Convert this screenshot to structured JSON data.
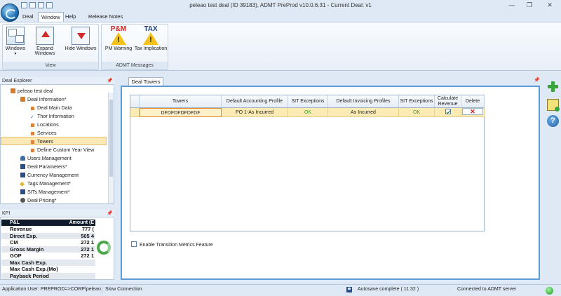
{
  "window": {
    "title": "peleao test deal (ID 39183), ADMT PreProd v10.0.6.31 - Current Deal: v1",
    "minimize_label": "—",
    "restore_label": "❐",
    "close_label": "✕"
  },
  "menu": {
    "tabs": [
      "Deal",
      "Window",
      "Help",
      "Release Notes"
    ],
    "active": "Window"
  },
  "ribbon": {
    "groups": [
      {
        "label": "View",
        "buttons": [
          {
            "label": "Windows",
            "icon": "windows-icon"
          },
          {
            "label": "Expand Windows",
            "icon": "arrow-up-icon"
          },
          {
            "label": "Hide Windows",
            "icon": "arrow-down-icon"
          }
        ]
      },
      {
        "label": "ADMT Messages",
        "buttons": [
          {
            "label": "PM Warning",
            "icon": "pm-warning-icon",
            "icon_caption": "P&M"
          },
          {
            "label": "Tax Implication",
            "icon": "tax-warning-icon",
            "icon_caption": "TAX"
          }
        ]
      }
    ]
  },
  "deal_explorer": {
    "title": "Deal Explorer",
    "items": [
      {
        "label": "peleao test deal",
        "icon": "deal-icon"
      },
      {
        "label": "Deal Information*",
        "icon": "folder-icon"
      },
      {
        "label": "Deal Main Data",
        "icon": "item-icon"
      },
      {
        "label": "Thor Information",
        "icon": "check-icon"
      },
      {
        "label": "Locations",
        "icon": "item-icon"
      },
      {
        "label": "Services",
        "icon": "item-icon"
      },
      {
        "label": "Towers",
        "icon": "item-icon"
      },
      {
        "label": "Define Custom Year View",
        "icon": "item-icon"
      },
      {
        "label": "Users Management",
        "icon": "users-icon"
      },
      {
        "label": "Deal Parameters*",
        "icon": "parameters-icon"
      },
      {
        "label": "Currency Management",
        "icon": "currency-icon"
      },
      {
        "label": "Tags Management*",
        "icon": "tag-icon"
      },
      {
        "label": "SITs Management*",
        "icon": "sits-icon"
      },
      {
        "label": "Deal Pricing*",
        "icon": "pricing-icon"
      }
    ],
    "selected": "Towers"
  },
  "kpi": {
    "title": "KPI",
    "header": {
      "col1": "P&L",
      "col2": "Amount (E"
    },
    "rows": [
      {
        "label": "Revenue",
        "amount": "777 ("
      },
      {
        "label": "Direct Exp.",
        "amount": "505 4"
      },
      {
        "label": "CM",
        "amount": "272 1"
      },
      {
        "label": "Gross Margin",
        "amount": "272 1"
      },
      {
        "label": "GOP",
        "amount": "272 1"
      },
      {
        "label": "Max Cash Exp.",
        "amount": ""
      },
      {
        "label": "Max Cash Exp.(Mo)",
        "amount": ""
      },
      {
        "label": "Payback Period",
        "amount": ""
      }
    ]
  },
  "document": {
    "tab_label": "Deal Towers",
    "grid": {
      "columns": [
        "Towers",
        "Default Accounting Profile",
        "SIT Exceptions",
        "Default Invoicing Profiles",
        "SIT Exceptions",
        "Calculate Revenue",
        "Delete"
      ],
      "rows": [
        {
          "tower": "DFDFDFDFDFDF",
          "accounting_profile": "PO 1-As Incurred",
          "sit_exceptions_1": "OK",
          "invoicing_profile": "As Incurred",
          "sit_exceptions_2": "OK",
          "calculate_revenue": true,
          "delete_label": "✕"
        }
      ]
    },
    "transition_label": "Enable Transition Metrics Feature",
    "transition_checked": false
  },
  "side_actions": [
    {
      "name": "add-icon"
    },
    {
      "name": "notes-icon"
    },
    {
      "name": "help-icon",
      "label": "?"
    }
  ],
  "status": {
    "user": "Application User: PREPROD=>CORP\\peleao",
    "connection_speed": "Slow Connection",
    "autosave": "Autosave complete ( 11:32 )",
    "server": "Connected to ADMT server"
  },
  "colors": {
    "accent": "#5b9bd5",
    "selected_row": "#fdebb5",
    "ok_text": "#3a9a2a",
    "delete": "#d21f1f"
  }
}
